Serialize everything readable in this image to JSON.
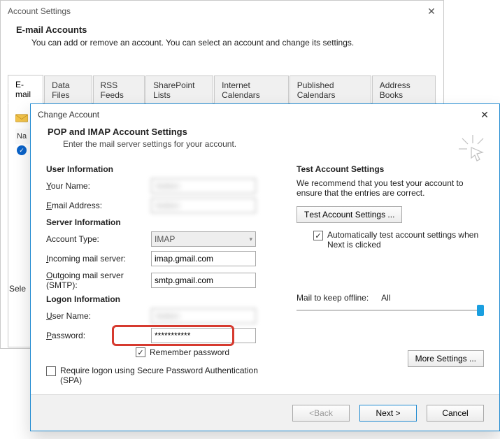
{
  "backWindow": {
    "title": "Account Settings",
    "heading": "E-mail Accounts",
    "subtext": "You can add or remove an account. You can select an account and change its settings.",
    "tabs": [
      "E-mail",
      "Data Files",
      "RSS Feeds",
      "SharePoint Lists",
      "Internet Calendars",
      "Published Calendars",
      "Address Books"
    ],
    "nameHeader": "Na",
    "selectLabel": "Sele"
  },
  "frontWindow": {
    "title": "Change Account",
    "headerTitle": "POP and IMAP Account Settings",
    "headerSub": "Enter the mail server settings for your account.",
    "sections": {
      "userInfo": "User Information",
      "serverInfo": "Server Information",
      "logonInfo": "Logon Information",
      "testHeader": "Test Account Settings",
      "testDesc": "We recommend that you test your account to ensure that the entries are correct."
    },
    "labels": {
      "yourName": "Your Name:",
      "emailAddr": "Email Address:",
      "acctType": "Account Type:",
      "incoming": "Incoming mail server:",
      "outgoing": "Outgoing mail server (SMTP):",
      "username": "User Name:",
      "password": "Password:",
      "remember": "Remember password",
      "spa": "Require logon using Secure Password Authentication (SPA)",
      "testBtn": "Test Account Settings ...",
      "autoTest": "Automatically test account settings when Next is clicked",
      "mailOffline": "Mail to keep offline:",
      "mailOfflineVal": "All",
      "moreSettings": "More Settings ..."
    },
    "values": {
      "yourName": "hidden",
      "emailAddr": "hidden",
      "acctType": "IMAP",
      "incoming": "imap.gmail.com",
      "outgoing": "smtp.gmail.com",
      "username": "hidden",
      "password": "***********"
    },
    "footer": {
      "back": "< Back",
      "next": "Next >",
      "cancel": "Cancel"
    }
  }
}
